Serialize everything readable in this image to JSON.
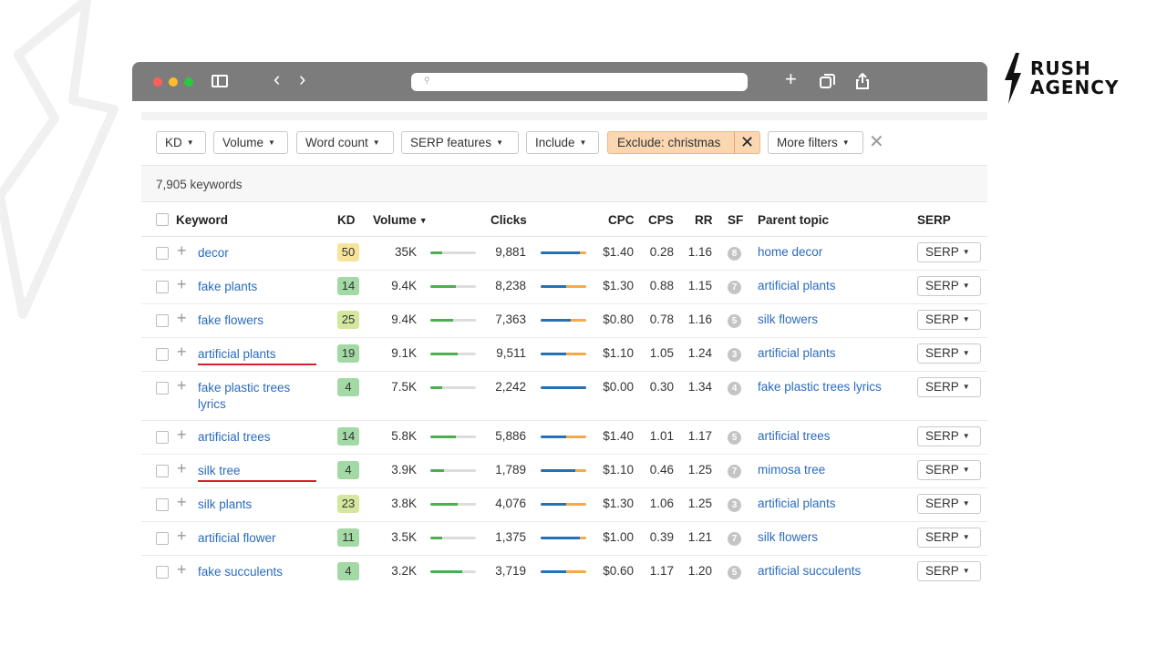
{
  "brand": {
    "line1": "RUSH",
    "line2": "AGENCY"
  },
  "filters": {
    "kd": "KD",
    "volume": "Volume",
    "word_count": "Word count",
    "serp_features": "SERP features",
    "include": "Include",
    "exclude": "Exclude: christmas",
    "more": "More filters"
  },
  "count_label": "7,905 keywords",
  "headers": {
    "keyword": "Keyword",
    "kd": "KD",
    "volume": "Volume",
    "clicks": "Clicks",
    "cpc": "CPC",
    "cps": "CPS",
    "rr": "RR",
    "sf": "SF",
    "parent": "Parent topic",
    "serp": "SERP"
  },
  "colors": {
    "kd_yellow": "#f8e39a",
    "kd_green": "#a3d9a5",
    "kd_lime": "#d4e79e",
    "link": "#2a6bbf",
    "exclude_bg": "#fad6b1"
  },
  "rows": [
    {
      "keyword": "decor",
      "kd": "50",
      "kd_color": "#f8e39a",
      "volume": "35K",
      "vol_level": 0.25,
      "clicks": "9,881",
      "click_share": 0.85,
      "cpc": "$1.40",
      "cps": "0.28",
      "rr": "1.16",
      "sf": "8",
      "parent": "home decor",
      "serp": "SERP",
      "underline": false
    },
    {
      "keyword": "fake plants",
      "kd": "14",
      "kd_color": "#a3d9a5",
      "volume": "9.4K",
      "vol_level": 0.55,
      "clicks": "8,238",
      "click_share": 0.55,
      "cpc": "$1.30",
      "cps": "0.88",
      "rr": "1.15",
      "sf": "7",
      "parent": "artificial plants",
      "serp": "SERP",
      "underline": false
    },
    {
      "keyword": "fake flowers",
      "kd": "25",
      "kd_color": "#d4e79e",
      "volume": "9.4K",
      "vol_level": 0.5,
      "clicks": "7,363",
      "click_share": 0.65,
      "cpc": "$0.80",
      "cps": "0.78",
      "rr": "1.16",
      "sf": "5",
      "parent": "silk flowers",
      "serp": "SERP",
      "underline": false
    },
    {
      "keyword": "artificial plants",
      "kd": "19",
      "kd_color": "#a3d9a5",
      "volume": "9.1K",
      "vol_level": 0.6,
      "clicks": "9,511",
      "click_share": 0.55,
      "cpc": "$1.10",
      "cps": "1.05",
      "rr": "1.24",
      "sf": "3",
      "parent": "artificial plants",
      "serp": "SERP",
      "underline": true
    },
    {
      "keyword": "fake plastic trees lyrics",
      "kd": "4",
      "kd_color": "#a3d9a5",
      "volume": "7.5K",
      "vol_level": 0.25,
      "clicks": "2,242",
      "click_share": 1.0,
      "cpc": "$0.00",
      "cps": "0.30",
      "rr": "1.34",
      "sf": "4",
      "parent": "fake plastic trees lyrics",
      "serp": "SERP",
      "underline": false
    },
    {
      "keyword": "artificial trees",
      "kd": "14",
      "kd_color": "#a3d9a5",
      "volume": "5.8K",
      "vol_level": 0.55,
      "clicks": "5,886",
      "click_share": 0.55,
      "cpc": "$1.40",
      "cps": "1.01",
      "rr": "1.17",
      "sf": "5",
      "parent": "artificial trees",
      "serp": "SERP",
      "underline": false
    },
    {
      "keyword": "silk tree",
      "kd": "4",
      "kd_color": "#a3d9a5",
      "volume": "3.9K",
      "vol_level": 0.3,
      "clicks": "1,789",
      "click_share": 0.75,
      "cpc": "$1.10",
      "cps": "0.46",
      "rr": "1.25",
      "sf": "7",
      "parent": "mimosa tree",
      "serp": "SERP",
      "underline": true
    },
    {
      "keyword": "silk plants",
      "kd": "23",
      "kd_color": "#d4e79e",
      "volume": "3.8K",
      "vol_level": 0.6,
      "clicks": "4,076",
      "click_share": 0.55,
      "cpc": "$1.30",
      "cps": "1.06",
      "rr": "1.25",
      "sf": "3",
      "parent": "artificial plants",
      "serp": "SERP",
      "underline": false
    },
    {
      "keyword": "artificial flower",
      "kd": "11",
      "kd_color": "#a3d9a5",
      "volume": "3.5K",
      "vol_level": 0.25,
      "clicks": "1,375",
      "click_share": 0.85,
      "cpc": "$1.00",
      "cps": "0.39",
      "rr": "1.21",
      "sf": "7",
      "parent": "silk flowers",
      "serp": "SERP",
      "underline": false
    },
    {
      "keyword": "fake succulents",
      "kd": "4",
      "kd_color": "#a3d9a5",
      "volume": "3.2K",
      "vol_level": 0.7,
      "clicks": "3,719",
      "click_share": 0.55,
      "cpc": "$0.60",
      "cps": "1.17",
      "rr": "1.20",
      "sf": "5",
      "parent": "artificial succulents",
      "serp": "SERP",
      "underline": false
    }
  ]
}
